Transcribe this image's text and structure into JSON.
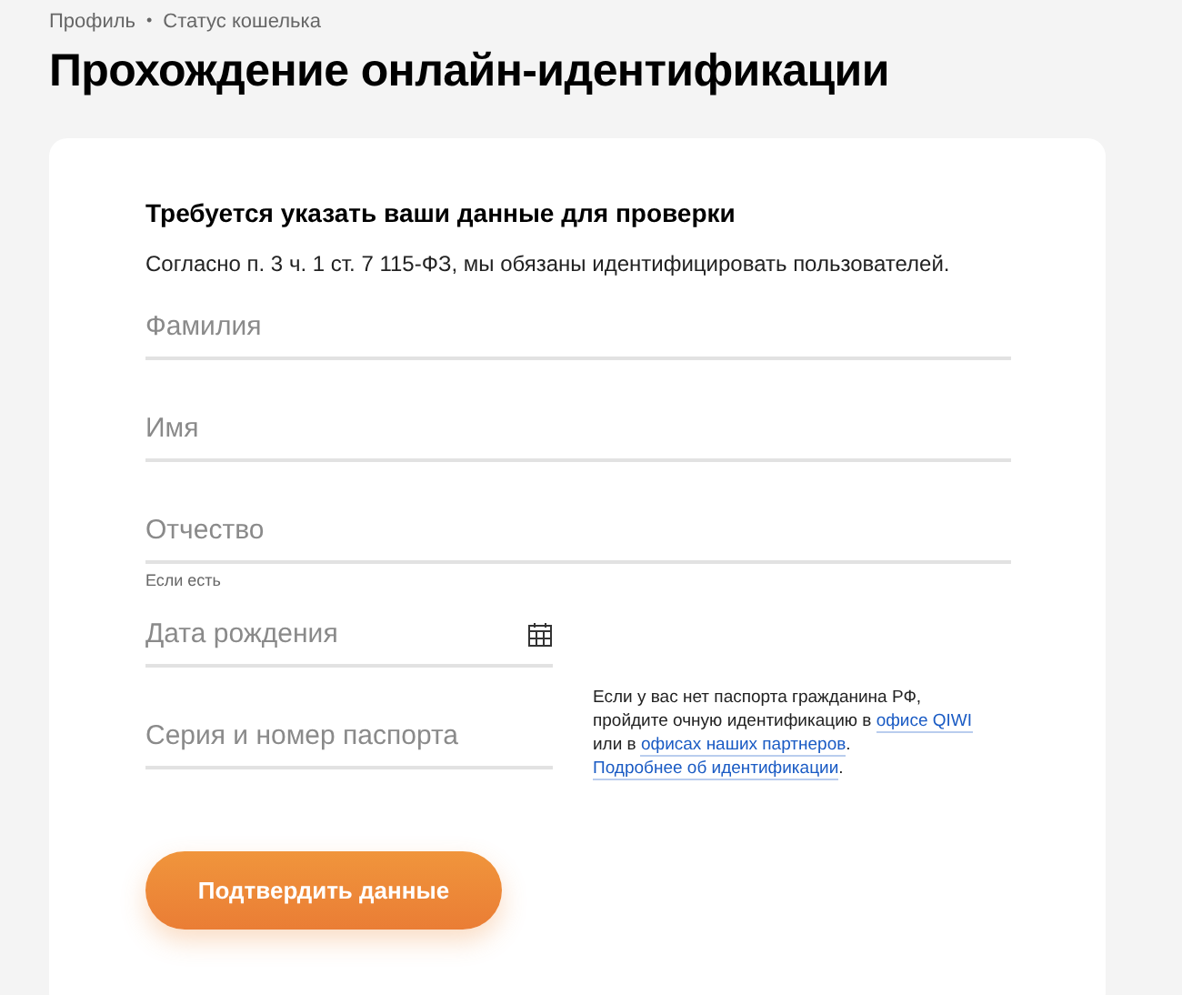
{
  "breadcrumb": [
    {
      "kind": "link",
      "text": "Профиль"
    },
    {
      "kind": "separator",
      "text": "•"
    },
    {
      "kind": "text",
      "text": "Статус кошелька"
    }
  ],
  "title": "Прохождение онлайн-идентификации",
  "form": {
    "heading": "Требуется указать ваши данные для проверки",
    "description": "Согласно п. 3 ч. 1 ст. 7 115-ФЗ, мы обязаны идентифицировать пользователей.",
    "fields": [
      {
        "kind": "wide",
        "placeholder": "Фамилия"
      },
      {
        "kind": "wide",
        "placeholder": "Имя"
      },
      {
        "kind": "wide",
        "placeholder": "Отчество",
        "hint": "Если есть"
      },
      {
        "kind": "date",
        "placeholder": "Дата рождения"
      },
      {
        "kind": "passport",
        "placeholder": "Серия и номер паспорта"
      }
    ],
    "note_lines": [
      [
        {
          "kind": "text",
          "text": "Если у вас нет паспорта гражданина РФ,"
        }
      ],
      [
        {
          "kind": "text",
          "text": "пройдите очную идентификацию в "
        },
        {
          "kind": "link",
          "text": "офисе QIWI"
        }
      ],
      [
        {
          "kind": "text",
          "text": "или в "
        },
        {
          "kind": "link",
          "text": "офисах наших партнеров"
        },
        {
          "kind": "text",
          "text": "."
        }
      ],
      [
        {
          "kind": "link",
          "text": "Подробнее об идентификации"
        },
        {
          "kind": "text",
          "text": "."
        }
      ]
    ],
    "submit": "Подтвердить данные"
  }
}
